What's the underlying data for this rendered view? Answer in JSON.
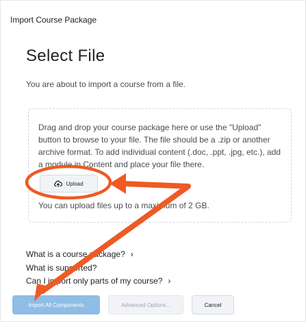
{
  "dialog": {
    "title": "Import Course Package"
  },
  "main": {
    "heading": "Select File",
    "intro": "You are about to import a course from a file."
  },
  "dropzone": {
    "instructions": "Drag and drop your course package here or use the \"Upload\" button to browse to your file. The file should be a .zip or another archive format. To add individual content (.doc, .ppt, .jpg, etc.), add a module in Content and place your file there.",
    "upload_label": "Upload",
    "upload_icon": "upload-cloud-icon",
    "limit": "You can upload files up to a maximum of 2 GB."
  },
  "help_links": [
    {
      "label": "What is a course package?"
    },
    {
      "label": "What is supported?"
    },
    {
      "label": "Can I import only parts of my course?"
    }
  ],
  "footer": {
    "import_all": "Import All Components",
    "advanced": "Advanced Options...",
    "cancel": "Cancel"
  },
  "colors": {
    "annotation": "#ee5a24",
    "primary_button": "#8fbde6"
  }
}
